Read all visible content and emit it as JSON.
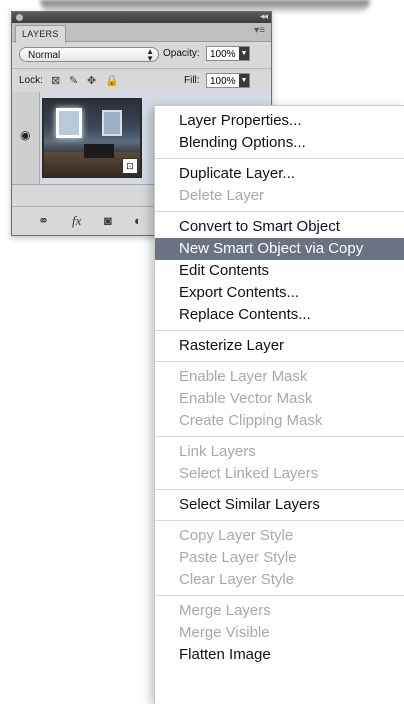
{
  "panel": {
    "tab_label": "LAYERS",
    "blend_mode": "Normal",
    "opacity_label": "Opacity:",
    "opacity_value": "100%",
    "lock_label": "Lock:",
    "fill_label": "Fill:",
    "fill_value": "100%",
    "icons": {
      "panel_menu": "panel-menu-icon",
      "lock_transparent": "checkerboard-icon",
      "lock_brush": "brush-icon",
      "lock_move": "move-icon",
      "lock_all": "padlock-icon",
      "visibility": "eye-icon",
      "smart_object": "smart-object-badge-icon",
      "link": "link-icon",
      "fx": "fx-icon",
      "mask": "mask-icon",
      "adjustment": "adjustment-icon"
    }
  },
  "menu": {
    "groups": [
      {
        "items": [
          {
            "label": "Layer Properties...",
            "state": "enabled"
          },
          {
            "label": "Blending Options...",
            "state": "enabled"
          }
        ]
      },
      {
        "items": [
          {
            "label": "Duplicate Layer...",
            "state": "enabled"
          },
          {
            "label": "Delete Layer",
            "state": "disabled"
          }
        ]
      },
      {
        "items": [
          {
            "label": "Convert to Smart Object",
            "state": "enabled"
          },
          {
            "label": "New Smart Object via Copy",
            "state": "highlighted"
          },
          {
            "label": "Edit Contents",
            "state": "enabled"
          },
          {
            "label": "Export Contents...",
            "state": "enabled"
          },
          {
            "label": "Replace Contents...",
            "state": "enabled"
          }
        ]
      },
      {
        "items": [
          {
            "label": "Rasterize Layer",
            "state": "enabled"
          }
        ]
      },
      {
        "items": [
          {
            "label": "Enable Layer Mask",
            "state": "disabled"
          },
          {
            "label": "Enable Vector Mask",
            "state": "disabled"
          },
          {
            "label": "Create Clipping Mask",
            "state": "disabled"
          }
        ]
      },
      {
        "items": [
          {
            "label": "Link Layers",
            "state": "disabled"
          },
          {
            "label": "Select Linked Layers",
            "state": "disabled"
          }
        ]
      },
      {
        "items": [
          {
            "label": "Select Similar Layers",
            "state": "enabled"
          }
        ]
      },
      {
        "items": [
          {
            "label": "Copy Layer Style",
            "state": "disabled"
          },
          {
            "label": "Paste Layer Style",
            "state": "disabled"
          },
          {
            "label": "Clear Layer Style",
            "state": "disabled"
          }
        ]
      },
      {
        "items": [
          {
            "label": "Merge Layers",
            "state": "disabled"
          },
          {
            "label": "Merge Visible",
            "state": "disabled"
          },
          {
            "label": "Flatten Image",
            "state": "enabled"
          }
        ]
      }
    ]
  },
  "colors": {
    "highlight": "#6a7284",
    "disabled_text": "#a9a9a9",
    "panel_bg": "#d8d8d8"
  }
}
